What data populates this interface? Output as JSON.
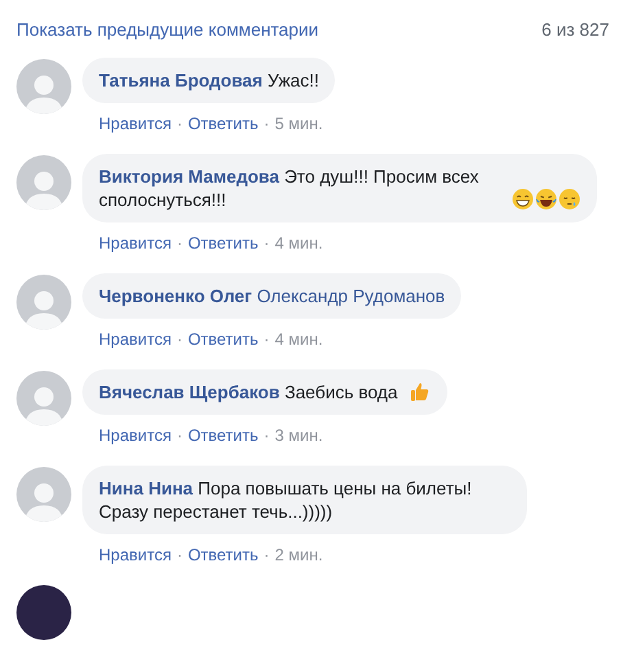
{
  "header": {
    "show_previous": "Показать предыдущие комментарии",
    "count": "6 из 827"
  },
  "comments": [
    {
      "kind": "plain",
      "author": "Татьяна Бродовая",
      "text": "Ужас!!",
      "like": "Нравится",
      "sep1": "·",
      "reply": "Ответить",
      "sep2": "·",
      "time": "5 мин."
    },
    {
      "kind": "faces",
      "author": "Виктория Мамедова",
      "text": "Это душ!!! Просим всех сполоснуться!!!",
      "like": "Нравится",
      "sep1": "·",
      "reply": "Ответить",
      "sep2": "·",
      "time": "4 мин."
    },
    {
      "kind": "plain",
      "author": "Червоненко Олег",
      "mention": "Олександр Рудоманов",
      "like": "Нравится",
      "sep1": "·",
      "reply": "Ответить",
      "sep2": "·",
      "time": "4 мин."
    },
    {
      "kind": "thumb",
      "author": "Вячеслав Щербаков",
      "text": "Заебись вода",
      "like": "Нравится",
      "sep1": "·",
      "reply": "Ответить",
      "sep2": "·",
      "time": "3 мин."
    },
    {
      "kind": "plain",
      "author": "Нина Нина",
      "text": "Пора повышать цены на билеты! Сразу перестанет течь...)))))",
      "like": "Нравится",
      "sep1": "·",
      "reply": "Ответить",
      "sep2": "·",
      "time": "2 мин."
    }
  ],
  "partial_avatar": true
}
